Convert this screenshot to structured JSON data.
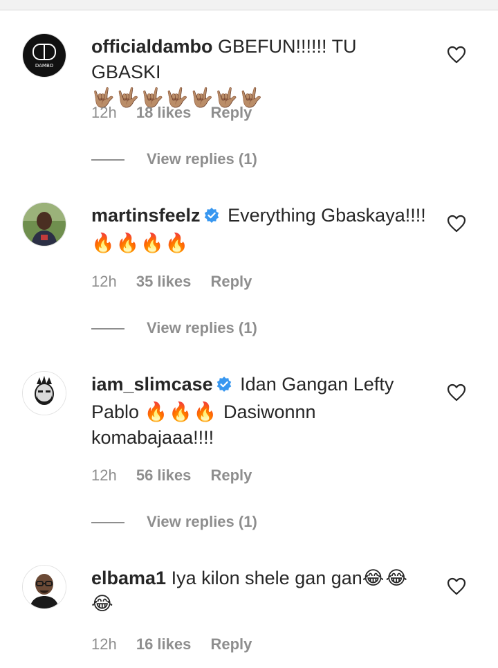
{
  "comments": [
    {
      "username": "officialdambo",
      "verified": false,
      "text": "GBEFUN!!!!!! TU GBASKI",
      "emojis": "🤟🏽🤟🏽🤟🏽🤟🏽🤟🏽🤟🏽🤟🏽",
      "time": "12h",
      "likes": "18 likes",
      "reply": "Reply",
      "view_replies": "View replies (1)",
      "avatar_text": "DAMBO"
    },
    {
      "username": "martinsfeelz",
      "verified": true,
      "text": "Everything Gbaskaya!!!!",
      "emojis": "🔥🔥🔥🔥",
      "time": "12h",
      "likes": "35 likes",
      "reply": "Reply",
      "view_replies": "View replies (1)"
    },
    {
      "username": "iam_slimcase",
      "verified": true,
      "text": "Idan Gangan Lefty Pablo",
      "emojis": "🔥🔥🔥",
      "text2": "Dasiwonnn komabajaaa!!!!",
      "time": "12h",
      "likes": "56 likes",
      "reply": "Reply",
      "view_replies": "View replies (1)"
    },
    {
      "username": "elbama1",
      "verified": false,
      "text": "Iya kilon shele gan gan",
      "emojis": "😂😂😂",
      "time": "12h",
      "likes": "16 likes",
      "reply": "Reply"
    }
  ],
  "colors": {
    "text": "#262626",
    "muted": "#8e8e8e",
    "verified": "#3897f0"
  },
  "icons": {
    "like": "heart-outline-icon",
    "verified": "verified-badge-icon"
  }
}
